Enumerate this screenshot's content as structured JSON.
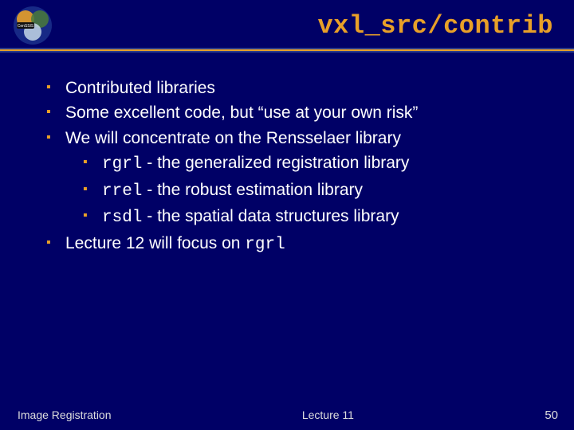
{
  "header": {
    "title": "vxl_src/contrib",
    "logo_name": "censsis-logo"
  },
  "bullets": [
    {
      "text": "Contributed libraries"
    },
    {
      "text": "Some excellent code, but “use at your own risk”"
    },
    {
      "text": "We will concentrate on the Rensselaer library",
      "children": [
        {
          "code": "rgrl",
          "text": " - the generalized registration library"
        },
        {
          "code": "rrel",
          "text": " - the robust estimation library"
        },
        {
          "code": "rsdl",
          "text": " - the spatial data structures library"
        }
      ]
    },
    {
      "prefix": "Lecture 12 will focus on ",
      "code": "rgrl"
    }
  ],
  "footer": {
    "left": "Image Registration",
    "center": "Lecture 11",
    "right": "50"
  }
}
